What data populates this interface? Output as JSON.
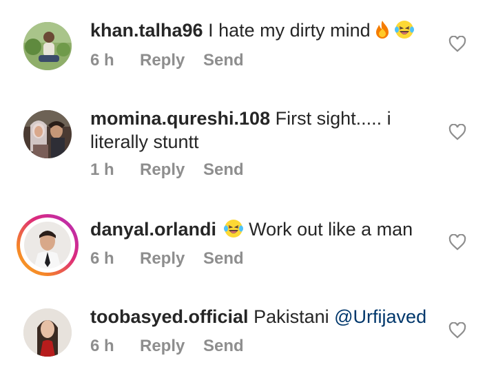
{
  "comments": [
    {
      "username": "khan.talha96",
      "text": "I hate my dirty mind",
      "emojis": [
        "fire-emoji",
        "laughing-tears-emoji"
      ],
      "time": "6 h",
      "reply_label": "Reply",
      "send_label": "Send"
    },
    {
      "username": "momina.qureshi.108",
      "text": "First sight..... i literally stuntt",
      "time": "1 h",
      "reply_label": "Reply",
      "send_label": "Send"
    },
    {
      "username": "danyal.orlandi",
      "emoji_before_text": "laughing-tears-emoji",
      "text": "Work out like a man",
      "time": "6 h",
      "reply_label": "Reply",
      "send_label": "Send",
      "has_story_ring": true
    },
    {
      "username": "toobasyed.official",
      "text": "Pakistani",
      "mention": "@Urfijaved",
      "time": "6 h",
      "reply_label": "Reply",
      "send_label": "Send"
    }
  ],
  "colors": {
    "text": "#262626",
    "meta": "#8e8e8e",
    "mention": "#00376b",
    "heart_outline": "#8e8e8e"
  },
  "icons": {
    "like": "heart-outline-icon"
  }
}
